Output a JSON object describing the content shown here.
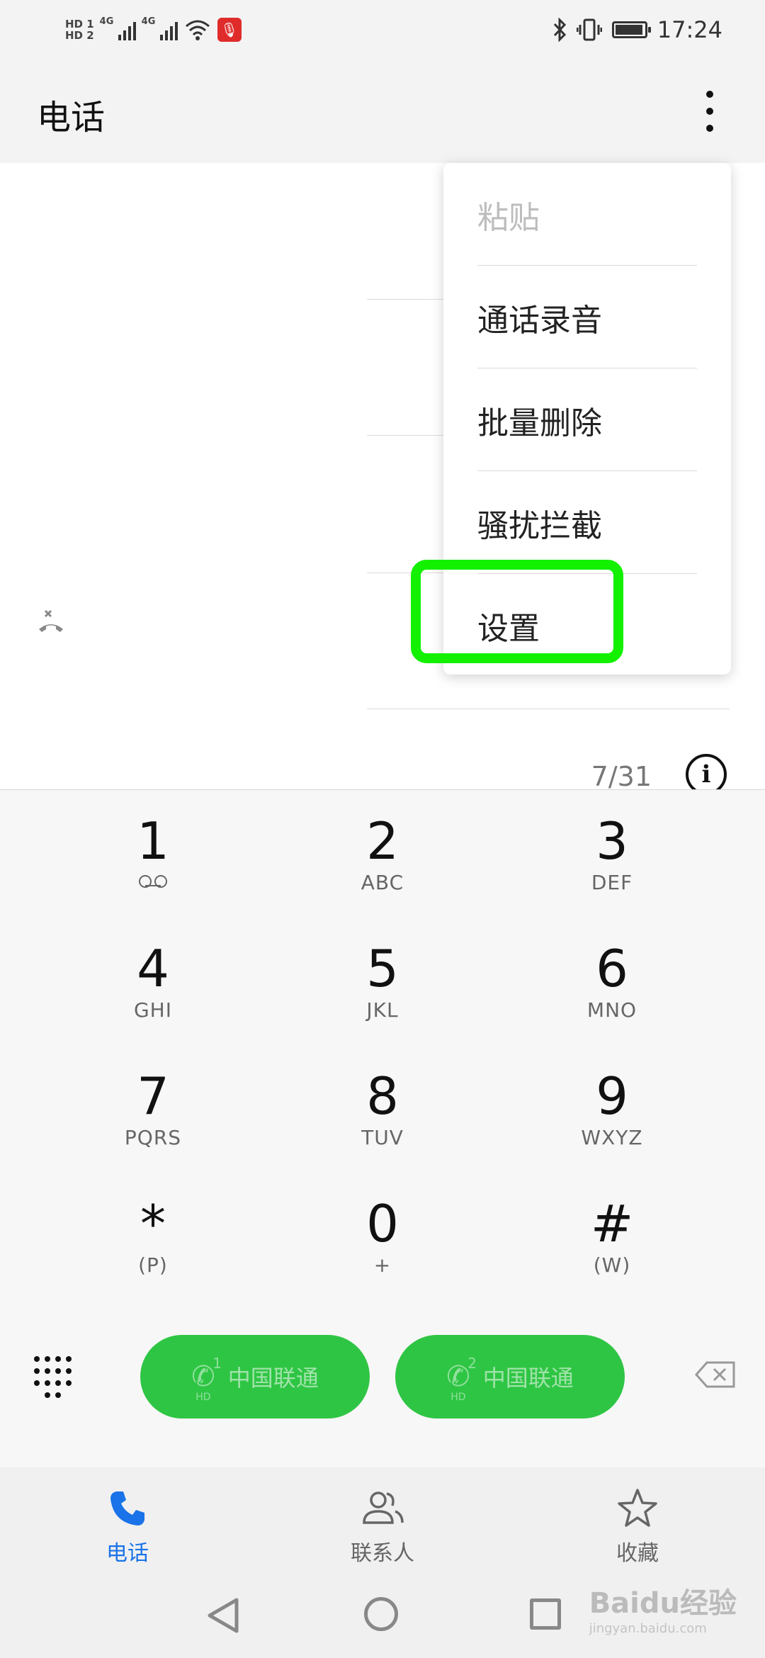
{
  "status_bar": {
    "hd1": "HD 1",
    "hd2": "HD 2",
    "net1": "4G",
    "net2": "4G",
    "time": "17:24",
    "icons": [
      "signal-icon",
      "wifi-icon",
      "mic-icon",
      "bluetooth-icon",
      "vibrate-icon",
      "battery-icon"
    ],
    "battery_level": 0.9
  },
  "header": {
    "title": "电话",
    "more_icon": "more-vert-icon"
  },
  "menu": {
    "items": [
      {
        "label": "粘贴",
        "enabled": false
      },
      {
        "label": "通话录音",
        "enabled": true
      },
      {
        "label": "批量删除",
        "enabled": true
      },
      {
        "label": "骚扰拦截",
        "enabled": true
      },
      {
        "label": "设置",
        "enabled": true,
        "highlighted": true
      }
    ]
  },
  "call_log": {
    "pager": "7/31",
    "info_icon": "info-icon",
    "missed_icon": "missed-call-icon"
  },
  "keypad": {
    "keys": [
      {
        "digit": "1",
        "letters": ""
      },
      {
        "digit": "2",
        "letters": "ABC"
      },
      {
        "digit": "3",
        "letters": "DEF"
      },
      {
        "digit": "4",
        "letters": "GHI"
      },
      {
        "digit": "5",
        "letters": "JKL"
      },
      {
        "digit": "6",
        "letters": "MNO"
      },
      {
        "digit": "7",
        "letters": "PQRS"
      },
      {
        "digit": "8",
        "letters": "TUV"
      },
      {
        "digit": "9",
        "letters": "WXYZ"
      },
      {
        "digit": "*",
        "letters": "(P)"
      },
      {
        "digit": "0",
        "letters": "+"
      },
      {
        "digit": "#",
        "letters": "(W)"
      }
    ],
    "call_buttons": [
      {
        "sim": "1",
        "hd": "HD",
        "carrier": "中国联通"
      },
      {
        "sim": "2",
        "hd": "HD",
        "carrier": "中国联通"
      }
    ],
    "accent_color": "#2fc544"
  },
  "tabs": [
    {
      "label": "电话",
      "icon": "phone-icon",
      "active": true
    },
    {
      "label": "联系人",
      "icon": "contacts-icon",
      "active": false
    },
    {
      "label": "收藏",
      "icon": "star-icon",
      "active": false
    }
  ],
  "watermark": {
    "brand": "Baidu经验",
    "url": "jingyan.baidu.com"
  }
}
